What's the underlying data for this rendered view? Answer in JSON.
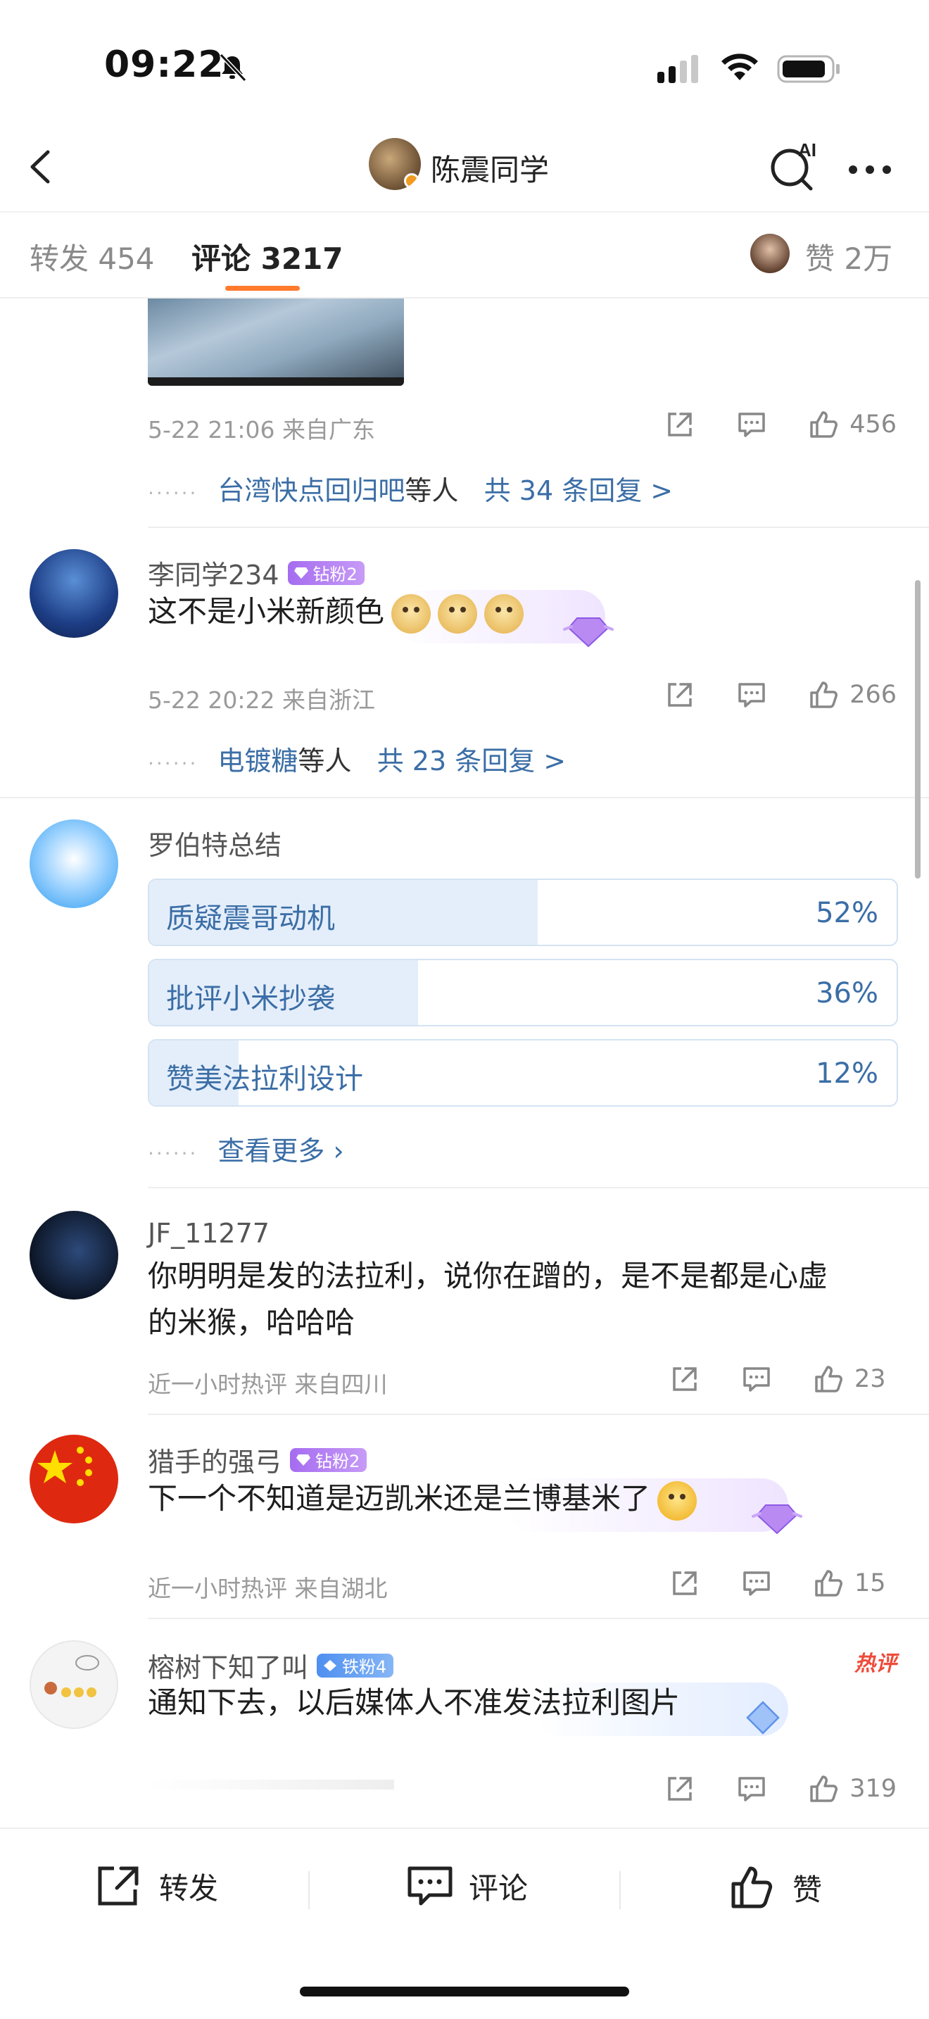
{
  "status_bar": {
    "time": "09:22"
  },
  "nav": {
    "title": "陈震同学"
  },
  "tabs": {
    "repost": "转发 454",
    "comments": "评论 3217",
    "likes": "赞 2万"
  },
  "comments": [
    {
      "meta": "5-22 21:06  来自广东",
      "like_count": "456",
      "replies_users": "台湾快点回归吧",
      "replies_mid": "等人",
      "replies_link": "共 34 条回复 >"
    },
    {
      "user": "李同学234",
      "badge": "钻粉2",
      "text": "这不是小米新颜色",
      "meta": "5-22 20:22  来自浙江",
      "like_count": "266",
      "replies_users": "电镀糖",
      "replies_mid": "等人",
      "replies_link": "共 23 条回复 >"
    },
    {
      "user": "罗伯特总结",
      "poll": [
        {
          "label": "质疑震哥动机",
          "percent_text": "52%",
          "value": 0.52
        },
        {
          "label": "批评小米抄袭",
          "percent_text": "36%",
          "value": 0.36
        },
        {
          "label": "赞美法拉利设计",
          "percent_text": "12%",
          "value": 0.12
        }
      ],
      "more": "查看更多 ›"
    },
    {
      "user": "JF_11277",
      "text_line1": "你明明是发的法拉利，说你在蹭的，是不是都是心虚",
      "text_line2": "的米猴，哈哈哈",
      "meta": "近一小时热评  来自四川",
      "like_count": "23"
    },
    {
      "user": "猎手的强弓",
      "badge": "钻粉2",
      "text": "下一个不知道是迈凯米还是兰博基米了",
      "meta": "近一小时热评  来自湖北",
      "like_count": "15"
    },
    {
      "user": "榕树下知了叫",
      "badge": "铁粉4",
      "hot": "热评",
      "text": "通知下去，以后媒体人不准发法拉利图片",
      "like_count": "319"
    }
  ],
  "bottom_bar": {
    "repost": "转发",
    "comment": "评论",
    "like": "赞"
  },
  "colors": {
    "link_blue": "#3b6ea6",
    "accent_orange": "#ff7a2c",
    "poll_fill": "#e4eefa",
    "hot_red": "#ef4b3a"
  }
}
